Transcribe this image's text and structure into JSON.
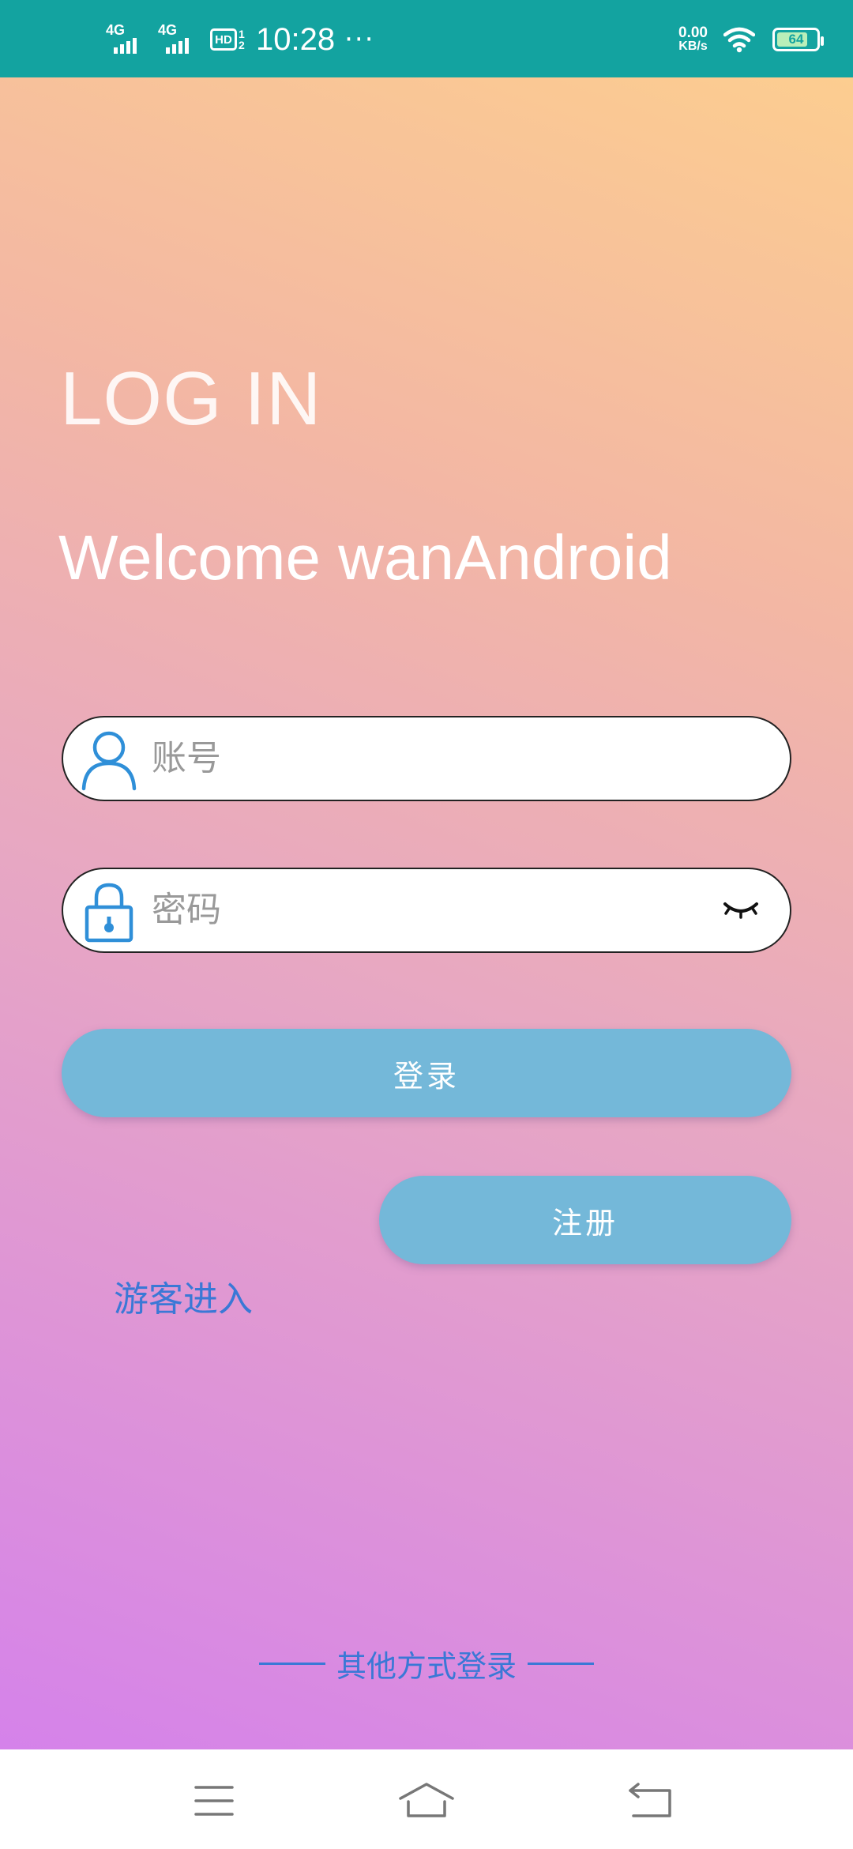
{
  "status_bar": {
    "time": "10:28",
    "network1": "4G",
    "network2": "4G",
    "hd_label": "HD",
    "hd_sub": "1 2",
    "more": "···",
    "speed_value": "0.00",
    "speed_unit": "KB/s",
    "battery_level": "64",
    "icons": [
      "signal-icon",
      "wifi-icon",
      "battery-icon"
    ]
  },
  "login": {
    "title": "LOG IN",
    "welcome": "Welcome wanAndroid",
    "account_placeholder": "账号",
    "password_placeholder": "密码",
    "login_button": "登录",
    "guest_link": "游客进入",
    "register_button": "注册",
    "other_methods": "其他方式登录"
  },
  "colors": {
    "status_bar": "#13a3a0",
    "button": "#74b8d9",
    "link": "#3a78d6",
    "icon_blue": "#2f8fd8",
    "gradient": [
      "#fccd90",
      "#f3b7a4",
      "#e7a7c3",
      "#d582ea"
    ]
  },
  "nav_bar": {
    "icons": [
      "menu-icon",
      "home-icon",
      "back-icon"
    ]
  }
}
